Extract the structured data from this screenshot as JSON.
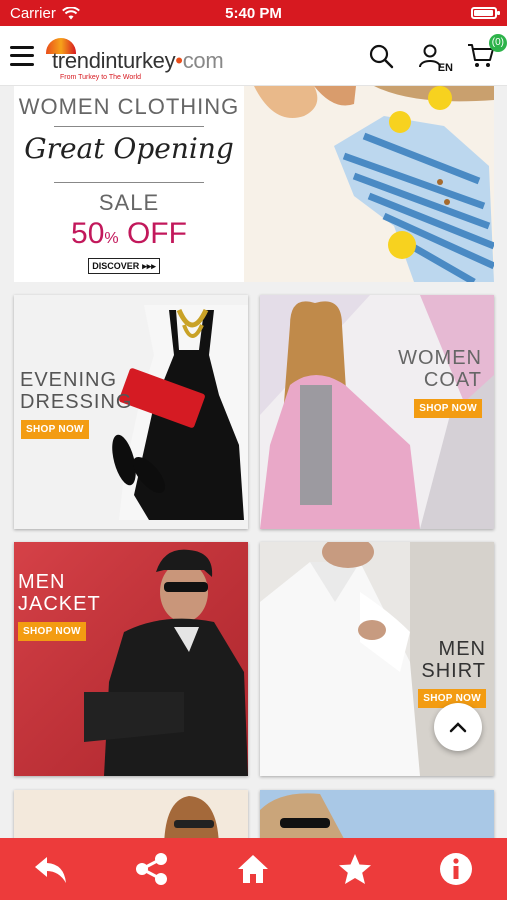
{
  "status_bar": {
    "carrier": "Carrier",
    "time": "5:40 PM",
    "battery_level": 0.95
  },
  "header": {
    "logo_main": "trendinturkey",
    "logo_dot": "•",
    "logo_com": "com",
    "logo_tagline": "From Turkey to The World",
    "language": "EN",
    "cart_count": "(0)"
  },
  "hero": {
    "line1": "WOMEN CLOTHING",
    "script": "Great Opening",
    "sale": "SALE",
    "off_number": "50",
    "off_percent": "%",
    "off_text": " OFF",
    "discover": "DISCOVER",
    "discover_arrows": "▸▸▸"
  },
  "tiles": [
    {
      "line1": "EVENING",
      "line2": "DRESSING",
      "button": "SHOP NOW"
    },
    {
      "line1": "WOMEN",
      "line2": "COAT",
      "button": "SHOP NOW"
    },
    {
      "line1": "MEN",
      "line2": "JACKET",
      "button": "SHOP NOW"
    },
    {
      "line1": "MEN",
      "line2": "SHIRT",
      "button": "SHOP NOW"
    }
  ],
  "colors": {
    "brand_red": "#d71920",
    "bottom_bar": "#ed3b3b",
    "shop_now": "#f39c12",
    "cart_badge": "#2db34a",
    "sale_pink": "#c2185b"
  },
  "bottom_nav": [
    "back-icon",
    "share-icon",
    "home-icon",
    "star-icon",
    "info-icon"
  ]
}
